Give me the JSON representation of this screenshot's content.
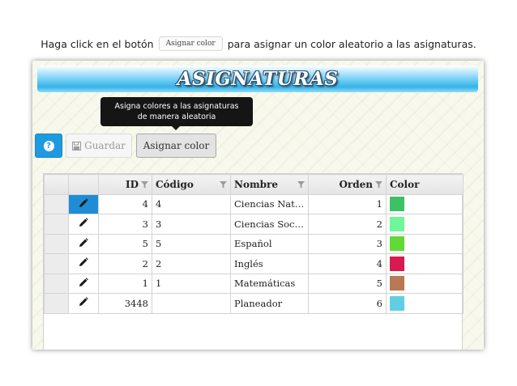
{
  "caption": {
    "before": "Haga click en el botón",
    "button_label": "Asignar color",
    "after": "para asignar un color aleatorio a las asignaturas."
  },
  "banner": {
    "title": "ASIGNATURAS"
  },
  "tooltip": {
    "line1": "Asigna colores a las asignaturas",
    "line2": "de manera aleatoria"
  },
  "toolbar": {
    "help_icon": "question-icon",
    "save_label": "Guardar",
    "save_icon": "floppy-disk-icon",
    "assign_color_label": "Asignar color"
  },
  "grid": {
    "columns": [
      "ID",
      "Código",
      "Nombre",
      "Orden",
      "Color"
    ],
    "rows": [
      {
        "id": "4",
        "codigo": "4",
        "nombre": "Ciencias Naturales",
        "orden": "1",
        "color": "#3cc265"
      },
      {
        "id": "3",
        "codigo": "3",
        "nombre": "Ciencias Sociales",
        "orden": "2",
        "color": "#6ef79a"
      },
      {
        "id": "5",
        "codigo": "5",
        "nombre": "Español",
        "orden": "3",
        "color": "#62d934"
      },
      {
        "id": "2",
        "codigo": "2",
        "nombre": "Inglés",
        "orden": "4",
        "color": "#d71a50"
      },
      {
        "id": "1",
        "codigo": "1",
        "nombre": "Matemáticas",
        "orden": "5",
        "color": "#b77a55"
      },
      {
        "id": "3448",
        "codigo": "",
        "nombre": "Planeador",
        "orden": "6",
        "color": "#61cfe3"
      }
    ]
  },
  "colors": {
    "accent": "#1f9ae0",
    "tooltip_bg": "#151515"
  }
}
